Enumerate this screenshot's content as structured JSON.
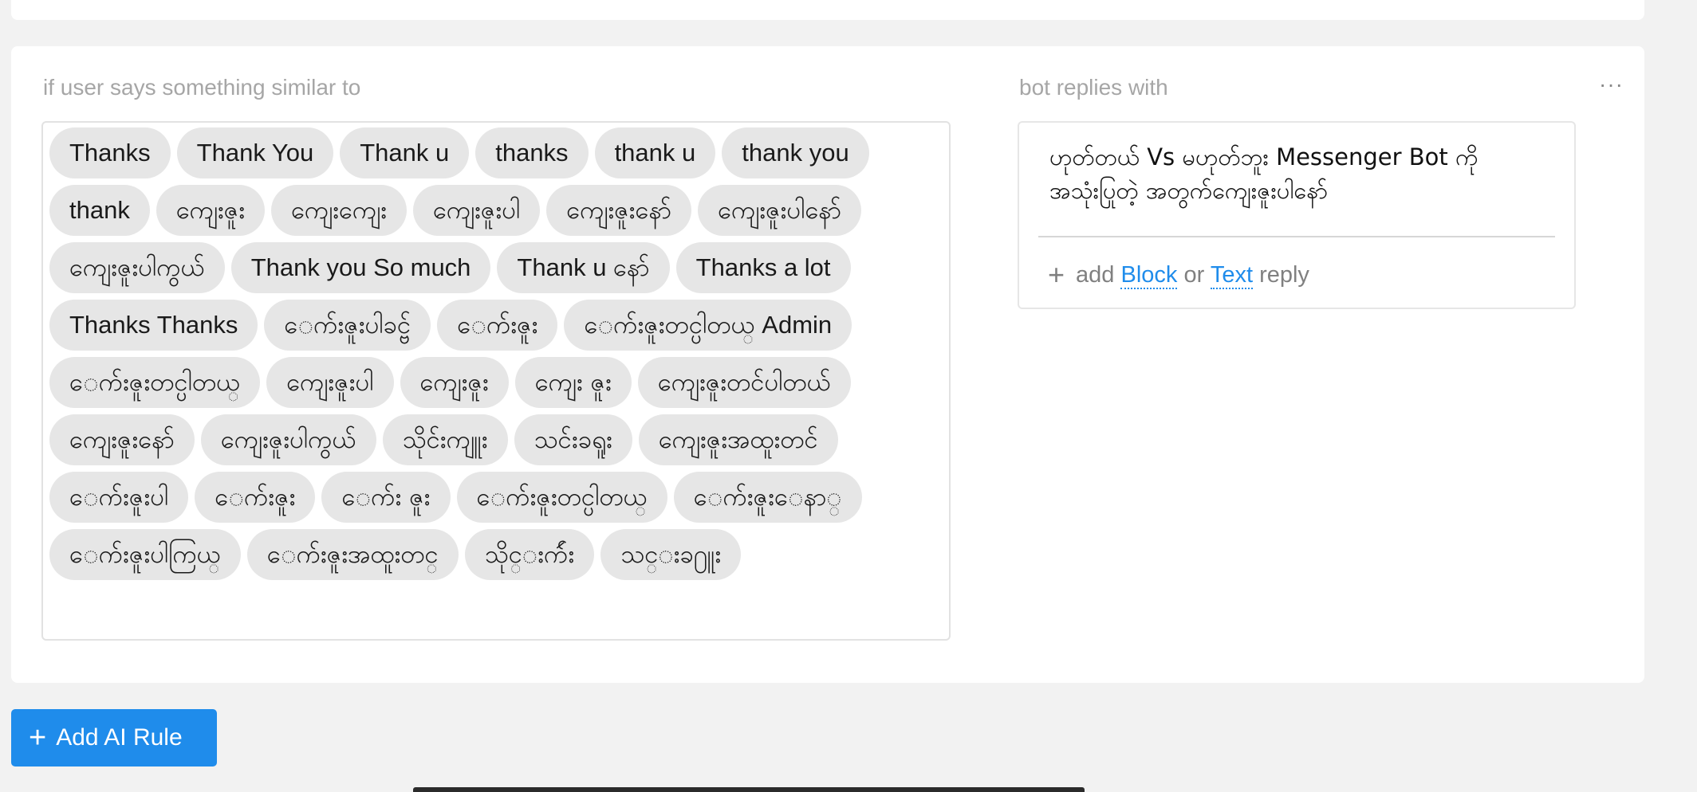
{
  "rule": {
    "user_label": "if user says something similar to",
    "bot_label": "bot replies with",
    "more_icon": "more-horizontal-icon",
    "phrases": [
      "Thanks",
      "Thank You",
      "Thank u",
      "thanks",
      "thank u",
      "thank you",
      "thank",
      "ကျေးဇူး",
      "ကျေးကျေး",
      "ကျေးဇူးပါ",
      "ကျေးဇူးနော်",
      "ကျေးဇူးပါနော်",
      "ကျေးဇူးပါကွယ်",
      "Thank you So much",
      "Thank u နော်",
      "Thanks a lot",
      "Thanks Thanks",
      "ေက်းဇူးပါခင္ဗ်",
      "ေက်းဇူး",
      "ေက်းဇူးတင္ပါတယ္ Admin",
      "ေက်းဇူးတင္ပါတယ္",
      "ကျေးဇူးပါ",
      "ကျေးဇူး",
      "ကျေး ဇူး",
      "ကျေးဇူးတင်ပါတယ်",
      "ကျေးဇူးနော်",
      "ကျေးဇူးပါကွယ်",
      "သိုင်းကျူး",
      "သင်းခရူး",
      "ကျေးဇူးအထူးတင်",
      "ေက်းဇူးပါ",
      "ေက်းဇူး",
      "ေက်း ဇူး",
      "ေက်းဇူးတင္ပါတယ္",
      "ေက်းဇူးေနာ္",
      "ေက်းဇူးပါကြယ္",
      "ေက်းဇူးအထူးတင္",
      "သိုင္းက်ဴး",
      "သင္းခ႐ူး"
    ],
    "reply_text": "ဟုတ်တယ် Vs မဟုတ်ဘူး Messenger Bot ကို အသုံးပြုတဲ့ အတွက်ကျေးဇူးပါနော်",
    "add_reply": {
      "prefix": "add",
      "block_link": "Block",
      "middle": "or",
      "text_link": "Text",
      "suffix": "reply"
    }
  },
  "add_ai_rule_label": "Add AI Rule",
  "colors": {
    "accent": "#1f8ceb",
    "chip_bg": "#e6e6e6",
    "page_bg": "#f2f2f2"
  }
}
